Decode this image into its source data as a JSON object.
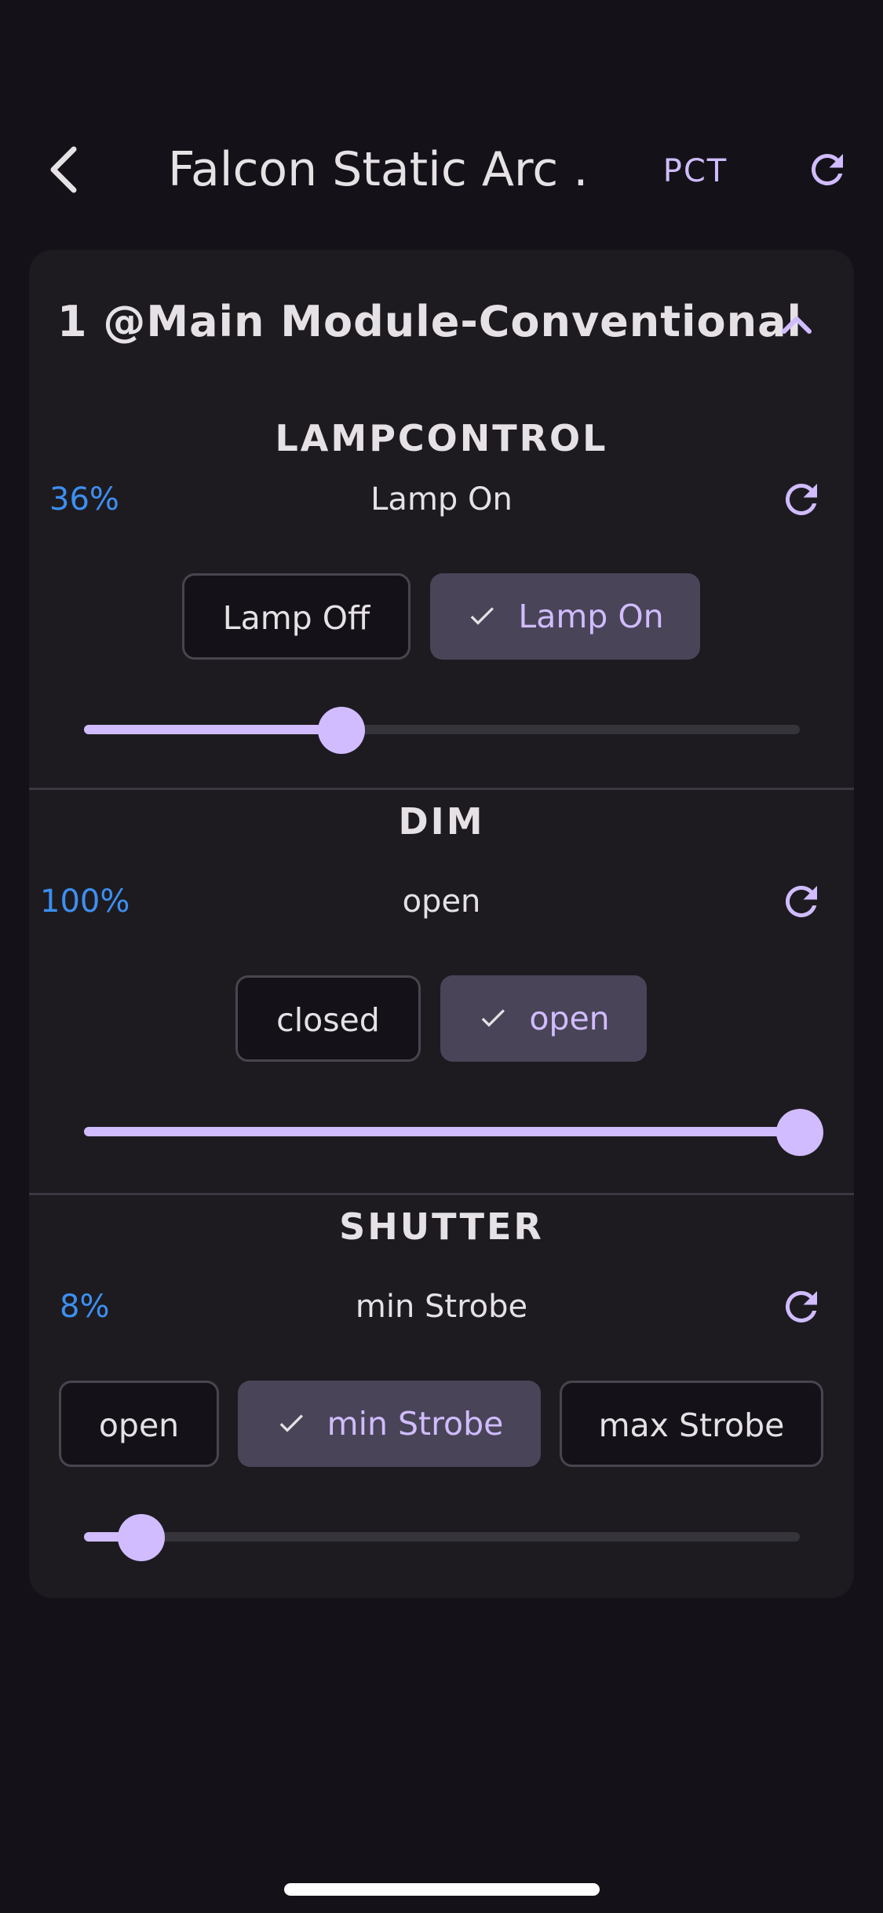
{
  "app": {
    "title": "Falcon Static Arc ...",
    "mode_button": "PCT"
  },
  "card": {
    "title": "1 @Main Module-Conventional"
  },
  "sections": [
    {
      "name": "LAMPCONTROL",
      "percent_label": "36%",
      "value": 0.36,
      "current_state": "Lamp On",
      "options": [
        {
          "label": "Lamp Off",
          "selected": false
        },
        {
          "label": "Lamp On",
          "selected": true
        }
      ]
    },
    {
      "name": "DIM",
      "percent_label": "100%",
      "value": 1.0,
      "current_state": "open",
      "options": [
        {
          "label": "closed",
          "selected": false
        },
        {
          "label": "open",
          "selected": true
        }
      ]
    },
    {
      "name": "SHUTTER",
      "percent_label": "8%",
      "value": 0.08,
      "current_state": "min Strobe",
      "options": [
        {
          "label": "open",
          "selected": false
        },
        {
          "label": "min Strobe",
          "selected": true
        },
        {
          "label": "max Strobe",
          "selected": false
        }
      ]
    }
  ],
  "colors": {
    "background": "#141218",
    "card": "#1d1b20",
    "accent": "#d0bcff",
    "selected_chip": "#4a4458",
    "percent_text": "#3c8ff0"
  },
  "icons": {
    "back": "chevron-left-icon",
    "refresh": "refresh-icon",
    "collapse": "chevron-up-icon",
    "check": "check-icon"
  }
}
